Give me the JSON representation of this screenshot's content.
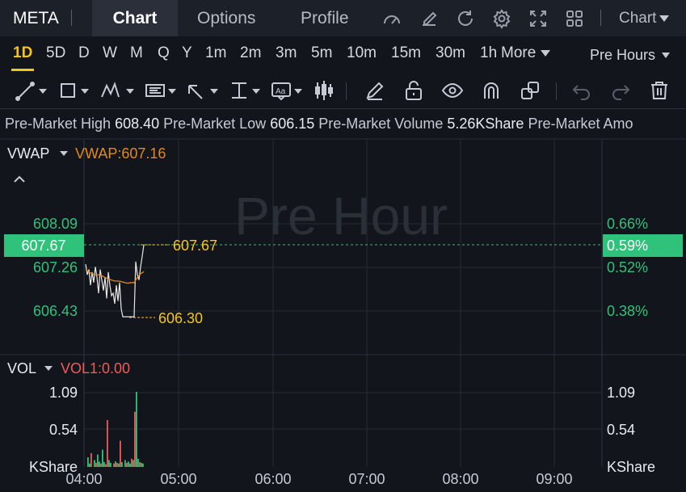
{
  "header": {
    "symbol": "META",
    "tabs": [
      "Chart",
      "Options",
      "Profile"
    ],
    "active_tab": "Chart",
    "chart_menu": "Chart",
    "icons": [
      "speed-gauge-icon",
      "edit-icon",
      "refresh-icon",
      "settings-icon",
      "fullscreen-icon",
      "grid-layout-icon"
    ]
  },
  "intervals": {
    "items": [
      "1D",
      "5D",
      "D",
      "W",
      "M",
      "Q",
      "Y",
      "1m",
      "2m",
      "3m",
      "5m",
      "10m",
      "15m",
      "30m",
      "1h"
    ],
    "active": "1D",
    "more_label": "More",
    "session_label": "Pre Hours"
  },
  "toolbar": {
    "tools": [
      "line-tool-icon",
      "rectangle-tool-icon",
      "pattern-tool-icon",
      "fibonacci-tool-icon",
      "arrow-tool-icon",
      "measure-tool-icon",
      "text-tool-icon",
      "candle-tool-icon",
      "pencil-icon",
      "unlock-icon",
      "eye-icon",
      "magnet-icon",
      "duplicate-icon",
      "undo-icon",
      "redo-icon",
      "trash-icon"
    ]
  },
  "info_bar": {
    "items": [
      {
        "label": "Pre-Market High",
        "value": "608.40"
      },
      {
        "label": "Pre-Market Low",
        "value": "606.15"
      },
      {
        "label": "Pre-Market Volume",
        "value": "5.26KShare"
      },
      {
        "label": "Pre-Market Amo",
        "value": ""
      }
    ]
  },
  "price_panel": {
    "indicator_name": "VWAP",
    "indicator_value": "VWAP:607.16",
    "watermark": "Pre Hour",
    "left_ticks": [
      "608.09",
      "607.26",
      "606.43"
    ],
    "right_ticks": [
      "0.66%",
      "0.52%",
      "0.38%"
    ],
    "current_price": "607.67",
    "current_pct": "0.59%",
    "high_marker": "607.67",
    "low_marker": "606.30"
  },
  "volume_panel": {
    "indicator_name": "VOL",
    "indicator_value": "VOL1:0.00",
    "left_ticks": [
      "1.09",
      "0.54",
      "KShare"
    ],
    "right_ticks": [
      "1.09",
      "0.54",
      "KShare"
    ]
  },
  "time_axis": [
    "04:00",
    "05:00",
    "06:00",
    "07:00",
    "08:00",
    "09:00"
  ],
  "colors": {
    "up": "#2fc27a",
    "down": "#ef5a5a",
    "accent": "#f5c518",
    "vwap": "#e08a1e",
    "price_line": "#e8e8e8"
  },
  "chart_data": [
    {
      "type": "line",
      "title": "",
      "x_unit": "minutes after 04:00",
      "series": [
        {
          "name": "",
          "x": [
            0,
            1,
            2,
            3,
            4,
            5,
            6,
            7,
            8,
            9,
            10,
            11,
            12,
            13,
            14,
            15,
            16,
            17,
            18,
            19,
            20,
            21,
            22,
            23,
            24,
            25,
            26,
            27,
            28,
            29,
            30,
            31,
            32,
            33,
            34,
            35,
            36
          ],
          "values": [
            607.3,
            607.1,
            607.2,
            606.9,
            607.15,
            606.95,
            607.25,
            607.05,
            606.75,
            607.2,
            607.0,
            606.8,
            607.05,
            606.65,
            607.15,
            606.9,
            606.7,
            606.75,
            606.55,
            606.9,
            606.6,
            606.95,
            606.45,
            606.3,
            606.3,
            606.3,
            606.3,
            606.3,
            606.3,
            606.3,
            606.3,
            607.35,
            607.1,
            607.0,
            607.25,
            607.45,
            607.67
          ]
        },
        {
          "name": "VWAP",
          "x": [
            0,
            2,
            4,
            6,
            8,
            10,
            12,
            14,
            16,
            18,
            20,
            22,
            24,
            26,
            28,
            30,
            32,
            34,
            36
          ],
          "values": [
            607.2,
            607.15,
            607.12,
            607.1,
            607.1,
            607.08,
            607.05,
            607.02,
            607.0,
            606.98,
            606.98,
            606.97,
            606.95,
            606.94,
            606.95,
            606.95,
            607.05,
            607.12,
            607.16
          ]
        }
      ],
      "xlim": [
        0,
        330
      ],
      "ylim": [
        606.0,
        608.5
      ]
    },
    {
      "type": "bar",
      "title": "",
      "ylabel": "KShare",
      "x": [
        1,
        2,
        3,
        5,
        6,
        7,
        8,
        9,
        10,
        11,
        12,
        13,
        14,
        15,
        17,
        18,
        19,
        20,
        21,
        22,
        24,
        25,
        26,
        27,
        28,
        29,
        30,
        31,
        32,
        33,
        34,
        35
      ],
      "values": [
        0.14,
        0.05,
        0.2,
        0.1,
        0.06,
        0.18,
        0.08,
        0.05,
        0.25,
        0.07,
        0.04,
        0.68,
        0.1,
        0.06,
        0.05,
        0.08,
        0.06,
        0.05,
        0.38,
        0.07,
        0.1,
        0.06,
        0.08,
        0.05,
        0.12,
        0.1,
        0.8,
        1.09,
        0.12,
        0.07,
        0.06,
        0.05
      ],
      "colors": [
        "up",
        "up",
        "down",
        "up",
        "down",
        "up",
        "up",
        "down",
        "up",
        "up",
        "down",
        "down",
        "up",
        "up",
        "down",
        "up",
        "down",
        "up",
        "down",
        "up",
        "up",
        "down",
        "up",
        "up",
        "down",
        "up",
        "down",
        "up",
        "up",
        "down",
        "up",
        "up"
      ],
      "ylim": [
        0,
        1.09
      ]
    }
  ]
}
